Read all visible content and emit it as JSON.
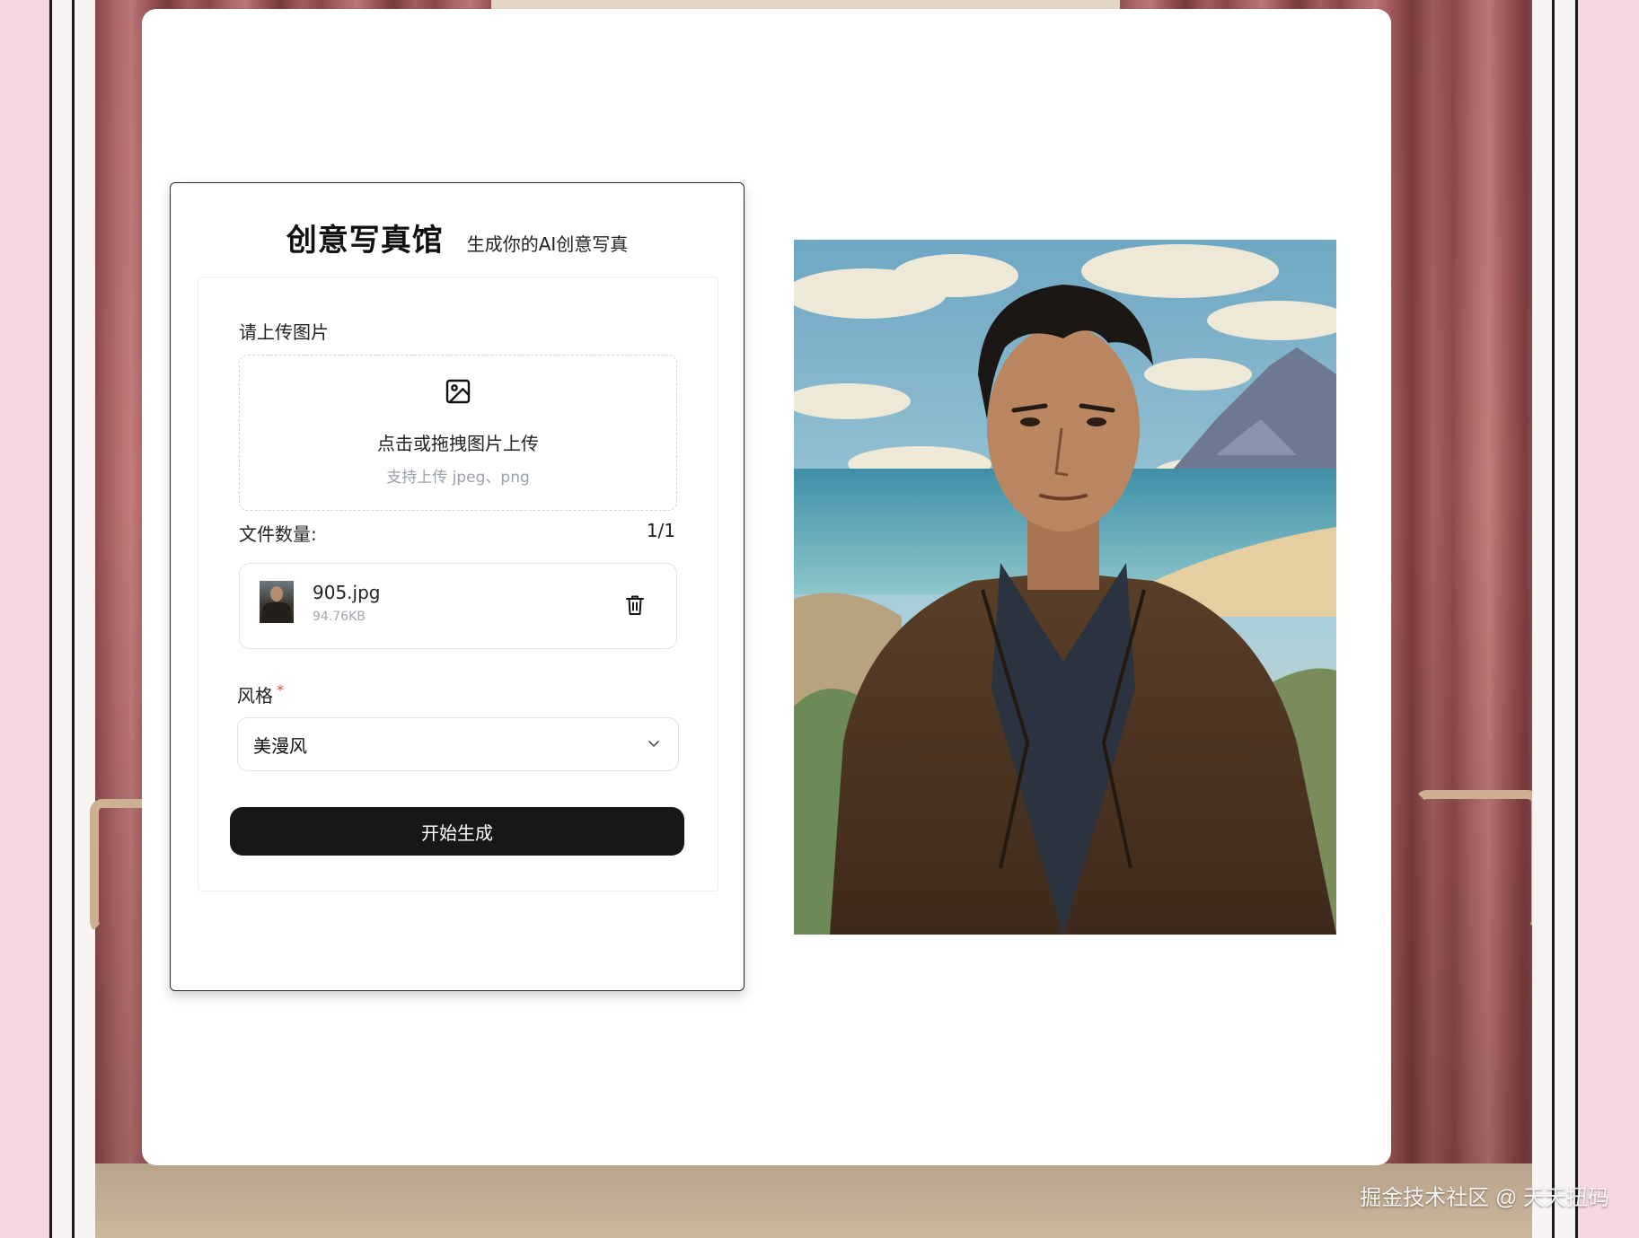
{
  "app": {
    "title": "创意写真馆",
    "subtitle": "生成你的AI创意写真"
  },
  "upload": {
    "label": "请上传图片",
    "dropzone_title": "点击或拖拽图片上传",
    "dropzone_hint": "支持上传 jpeg、png",
    "icon": "image-icon"
  },
  "file_count": {
    "label": "文件数量:",
    "value": "1/1"
  },
  "files": [
    {
      "name": "905.jpg",
      "size": "94.76KB",
      "delete_icon": "trash-icon"
    }
  ],
  "style": {
    "label": "风格",
    "required_mark": "*",
    "selected": "美漫风",
    "icon": "chevron-down-icon"
  },
  "generate_button": "开始生成",
  "watermark": "掘金技术社区 @ 天天扭码",
  "colors": {
    "button_bg": "#17171a",
    "required": "#e5484d",
    "background_pink": "#f5d6e1",
    "curtain": "#a95f61"
  }
}
